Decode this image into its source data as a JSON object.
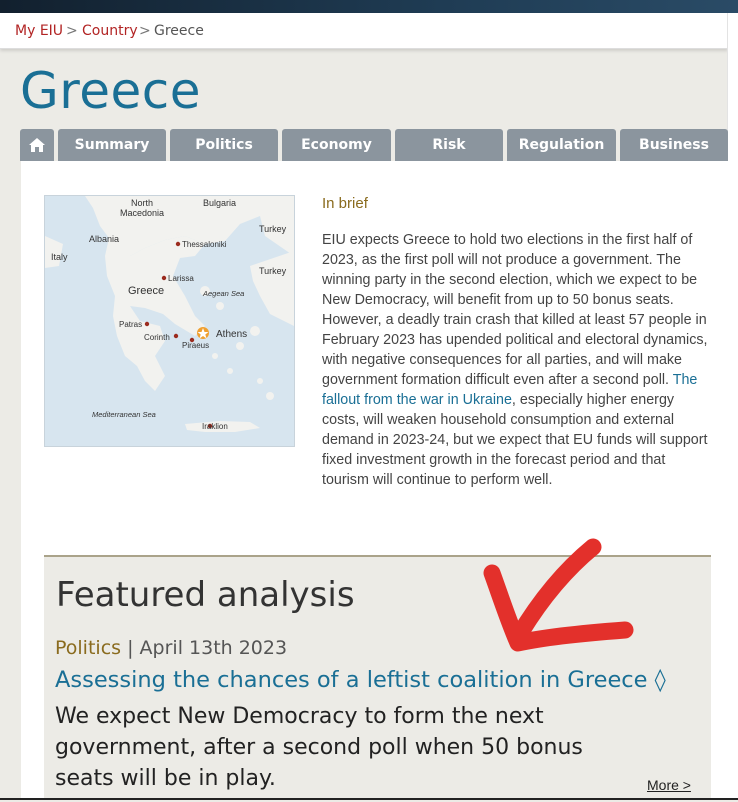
{
  "breadcrumb": {
    "items": [
      "My EIU",
      "Country",
      "Greece"
    ],
    "separator": ">"
  },
  "page": {
    "title": "Greece"
  },
  "tabs": [
    "Summary",
    "Politics",
    "Economy",
    "Risk",
    "Regulation",
    "Business"
  ],
  "home_icon": "home-icon",
  "map": {
    "labels": [
      "North Macedonia",
      "Bulgaria",
      "Albania",
      "Thessaloniki",
      "Turkey",
      "Italy",
      "Larissa",
      "Turkey",
      "Greece",
      "Aegean Sea",
      "Patras",
      "Athens",
      "Corinth",
      "Piraeus",
      "Mediterranean Sea",
      "Iraklion"
    ]
  },
  "in_brief": {
    "title": "In brief",
    "text_1": "EIU expects Greece to hold two elections in the first half of 2023, as the first poll will not produce a government. The winning party in the second election, which we expect to be New Democracy, will benefit from up to 50 bonus seats. However, a deadly train crash that killed at least 57 people in February 2023 has upended political and electoral dynamics, with negative consequences for all parties, and will make government formation difficult even after a second poll. ",
    "link_text": "The fallout from the war in Ukraine",
    "text_2": ", especially higher energy costs, will weaken household consumption and external demand in 2023-24, but we expect that EU funds will support fixed investment growth in the forecast period and that tourism will continue to perform well."
  },
  "featured": {
    "title": "Featured analysis",
    "category": "Politics",
    "meta_sep": "|",
    "date": "April 13th 2023",
    "link": "Assessing the chances of a leftist coalition in Greece ◊",
    "summary": "We expect New Democracy to form the next government, after a second poll when 50 bonus seats will be in play.",
    "more": "More >"
  },
  "colors": {
    "title_blue": "#1a6f95",
    "breadcrumb_red": "#b22424",
    "tab_grey": "#8b959e",
    "gold": "#8a6b1e",
    "annotation_red": "#e3302b"
  }
}
